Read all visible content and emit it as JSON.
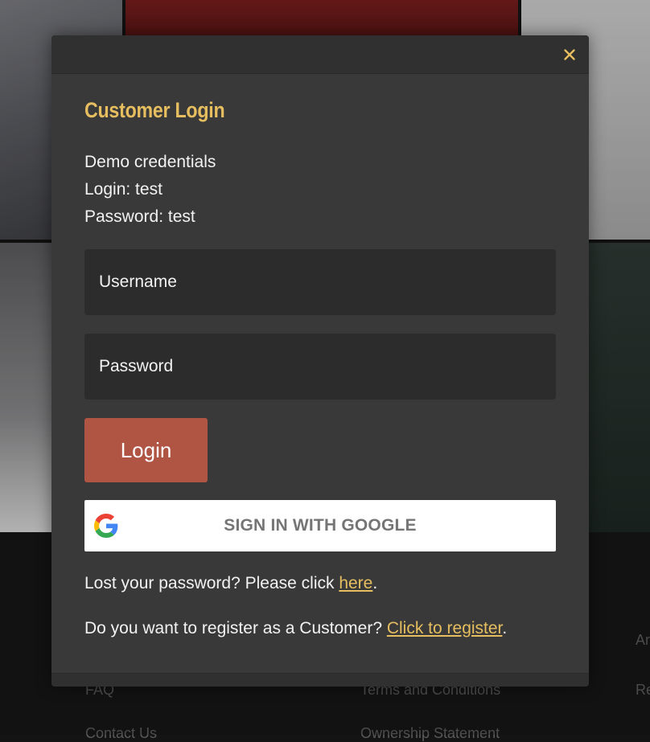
{
  "background": {
    "footer_links": [
      "FAQ",
      "Terms and Conditions",
      "Contact Us",
      "Ownership Statement",
      "Re",
      "Ar"
    ]
  },
  "modal": {
    "close_icon": "close-icon",
    "title": "Customer Login",
    "credentials": [
      "Demo credentials",
      "Login: test",
      "Password: test"
    ],
    "username_placeholder": "Username",
    "password_placeholder": "Password",
    "login_label": "Login",
    "google_label": "SIGN IN WITH GOOGLE",
    "lost_password": {
      "prefix": "Lost your password? Please click ",
      "link": "here",
      "suffix": "."
    },
    "register": {
      "prefix": "Do you want to register as a Customer? ",
      "link": "Click to register",
      "suffix": "."
    }
  },
  "colors": {
    "accent": "#e6be5f",
    "login_button": "#b05544",
    "modal_bg": "#393939",
    "input_bg": "#2c2c2c"
  }
}
